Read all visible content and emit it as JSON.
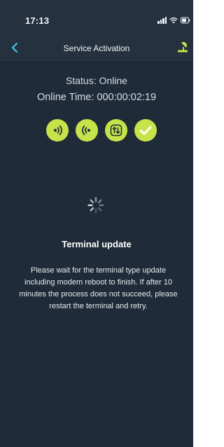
{
  "status_bar": {
    "time": "17:13"
  },
  "nav": {
    "title": "Service Activation"
  },
  "connection": {
    "status": "Status: Online",
    "online_time": "Online Time: 000:00:02:19"
  },
  "steps": [
    {
      "icon": "signal-out-icon",
      "done": true
    },
    {
      "icon": "signal-in-icon",
      "done": true
    },
    {
      "icon": "transfer-icon",
      "done": true
    },
    {
      "icon": "checkmark-icon",
      "done": true
    }
  ],
  "update": {
    "title": "Terminal update",
    "message_lines": [
      "Please wait for the terminal type update",
      "including modem reboot to finish. If after 10",
      "minutes the process does not succeed, please",
      "restart the terminal and retry."
    ]
  },
  "colors": {
    "background": "#1f2b38",
    "accent": "#c7e34a",
    "back_chevron": "#3fc6e0"
  }
}
